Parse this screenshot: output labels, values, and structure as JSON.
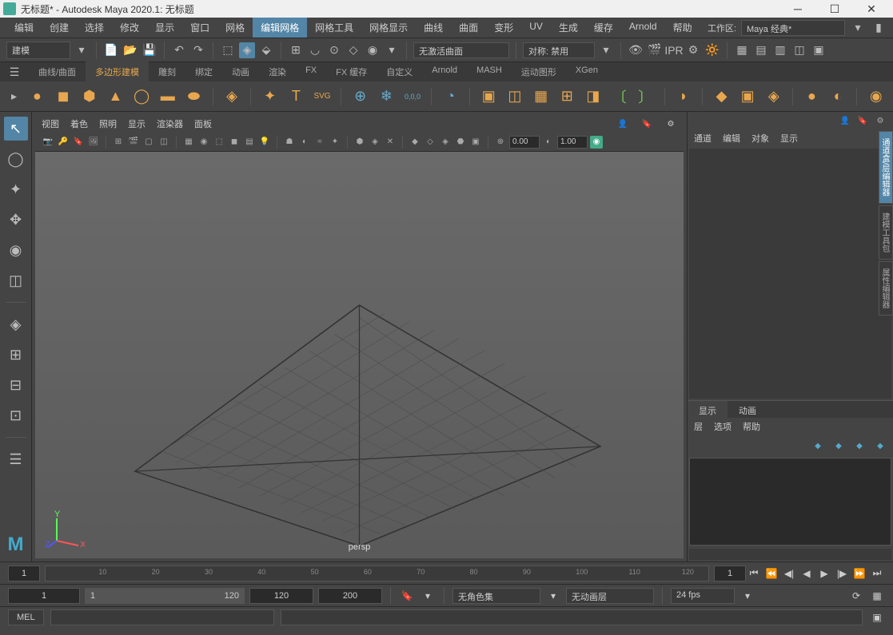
{
  "window": {
    "title": "无标题* - Autodesk Maya 2020.1: 无标题"
  },
  "menu": {
    "items": [
      "编辑",
      "创建",
      "选择",
      "修改",
      "显示",
      "窗口",
      "网格",
      "编辑网格",
      "网格工具",
      "网格显示",
      "曲线",
      "曲面",
      "变形",
      "UV",
      "生成",
      "缓存",
      "Arnold",
      "帮助"
    ],
    "active_index": 7
  },
  "workspace": {
    "label": "工作区:",
    "value": "Maya 经典*"
  },
  "mode": {
    "value": "建模"
  },
  "toolbar1": {
    "symmetry_label": "无激活曲面",
    "snap_label": "对称: 禁用"
  },
  "shelf": {
    "tabs": [
      "曲线/曲面",
      "多边形建模",
      "雕刻",
      "绑定",
      "动画",
      "渲染",
      "FX",
      "FX 缓存",
      "自定义",
      "Arnold",
      "MASH",
      "运动图形",
      "XGen"
    ],
    "active_index": 1
  },
  "viewport": {
    "menu": [
      "视图",
      "着色",
      "照明",
      "显示",
      "渲染器",
      "面板"
    ],
    "camera": "persp",
    "val1": "0.00",
    "val2": "1.00"
  },
  "channel": {
    "tabs": [
      "通道",
      "编辑",
      "对象",
      "显示"
    ]
  },
  "display_tabs": {
    "tabs": [
      "显示",
      "动画"
    ],
    "active": 0
  },
  "layers": {
    "tabs": [
      "层",
      "选项",
      "帮助"
    ]
  },
  "vtabs": [
    "通道盒/层编辑器",
    "建模工具包",
    "属性编辑器"
  ],
  "timeline": {
    "start": "1",
    "end": "1",
    "ticks": [
      "10",
      "20",
      "30",
      "40",
      "50",
      "60",
      "70",
      "80",
      "90",
      "100",
      "110",
      "120"
    ]
  },
  "range": {
    "start": "1",
    "rs": "1",
    "re": "120",
    "e1": "120",
    "e2": "200",
    "charset": "无角色集",
    "animlayer": "无动画层",
    "fps": "24 fps"
  },
  "cmd": {
    "label": "MEL"
  }
}
